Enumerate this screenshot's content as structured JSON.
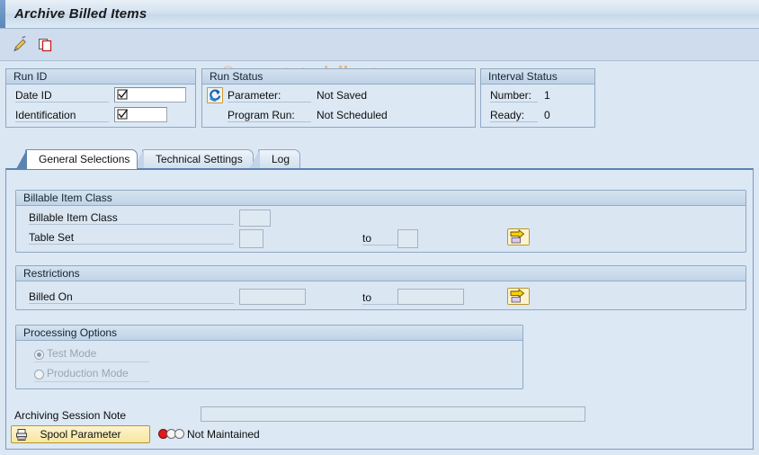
{
  "window": {
    "title": "Archive Billed Items"
  },
  "toolbar": {
    "icons": [
      {
        "name": "edit-pencil-icon",
        "label": "Edit"
      },
      {
        "name": "copy-icon",
        "label": "Copy"
      }
    ]
  },
  "watermark": {
    "text": "© www.tutorialkart.com",
    "color": "#e8b583"
  },
  "run_id": {
    "title": "Run ID",
    "date_id": {
      "label": "Date ID",
      "value": ""
    },
    "identification": {
      "label": "Identification",
      "value": ""
    }
  },
  "run_status": {
    "title": "Run Status",
    "refresh_icon": "refresh-icon",
    "parameter": {
      "label": "Parameter:",
      "value": "Not Saved"
    },
    "program_run": {
      "label": "Program Run:",
      "value": "Not Scheduled"
    }
  },
  "interval_status": {
    "title": "Interval Status",
    "number": {
      "label": "Number:",
      "value": "1"
    },
    "ready": {
      "label": "Ready:",
      "value": "0"
    }
  },
  "tabs": [
    {
      "label": "General Selections",
      "active": true
    },
    {
      "label": "Technical Settings",
      "active": false
    },
    {
      "label": "Log",
      "active": false
    }
  ],
  "billable_item_class": {
    "title": "Billable Item Class",
    "rows": [
      {
        "label": "Billable Item Class",
        "value": "",
        "to_label": "",
        "to_value": ""
      },
      {
        "label": "Table Set",
        "value": "",
        "to_label": "to",
        "to_value": ""
      }
    ],
    "multi_select_icon": "multiple-selection-arrow-icon"
  },
  "restrictions": {
    "title": "Restrictions",
    "rows": [
      {
        "label": "Billed On",
        "value": "",
        "to_label": "to",
        "to_value": ""
      }
    ],
    "multi_select_icon": "multiple-selection-arrow-icon"
  },
  "processing_options": {
    "title": "Processing Options",
    "options": [
      {
        "label": "Test Mode",
        "selected": true,
        "disabled": true
      },
      {
        "label": "Production Mode",
        "selected": false,
        "disabled": true
      }
    ]
  },
  "footer": {
    "note_label": "Archiving Session Note",
    "note_value": "",
    "note_placeholder": "",
    "spool_button": "Spool Parameter",
    "spool_icon": "printer-icon",
    "status_light": {
      "icon": "traffic-light-icon",
      "state_color": "#e01b1b",
      "text": "Not Maintained"
    }
  }
}
